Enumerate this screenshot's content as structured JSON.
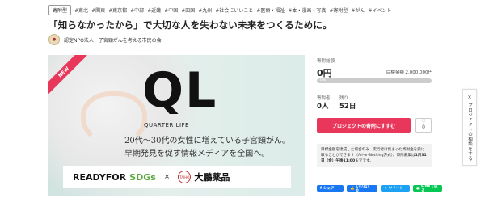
{
  "header": {
    "type_badge": "寄附型",
    "tags": [
      "#東北",
      "#関東",
      "#東京都",
      "#中部",
      "#近畿",
      "#中国",
      "#四国",
      "#九州",
      "#社会にいいこと",
      "#医療・福祉",
      "#本・漫画・写真",
      "#寄附型",
      "#がん",
      "#イベント"
    ],
    "title": "「知らなかったから」で大切な人を失わない未来をつくるために。",
    "org_name": "認定NPO法人　子宮頸がんを考える市民の会"
  },
  "hero": {
    "ribbon": "NEW",
    "logo_text": "QL",
    "logo_sub": "QUARTER LIFE",
    "line1": "20代～30代の女性に増えている子宮頸がん。",
    "line2": "早期発見を促す情報メディアを全国へ。",
    "partner_a": "READYFOR",
    "partner_a_sdgs": "SDGs",
    "partner_x": "×",
    "partner_logo": "TAIHO",
    "partner_b": "大鵬薬品"
  },
  "stats": {
    "donation_label": "寄附総額",
    "donation_amount": "0円",
    "goal_text": "目標金額 2,000,000円",
    "progress_label": "0%",
    "progress_fraction": 0,
    "donors_label": "寄附者",
    "donors_value": "0人",
    "remaining_label": "残り",
    "remaining_value": "52日"
  },
  "actions": {
    "support_label": "プロジェクトの寄附にすすむ",
    "fav_icon": "heart-icon",
    "fav_count": "0"
  },
  "notice": {
    "text1": "目標金額を達成した場合のみ、実行者は集まった寄附金を受け取ることができます（All-or-Nothing方式）。寄附募集は",
    "deadline": "1月31日（金）午後11:00",
    "text2": "までです。"
  },
  "share": {
    "facebook": "シェア",
    "like": "いいね！ 0",
    "twitter": "ツイート",
    "line": "LINEで送る"
  },
  "side_tab": {
    "close": "×",
    "label": "プロジェクトの相談をする"
  }
}
